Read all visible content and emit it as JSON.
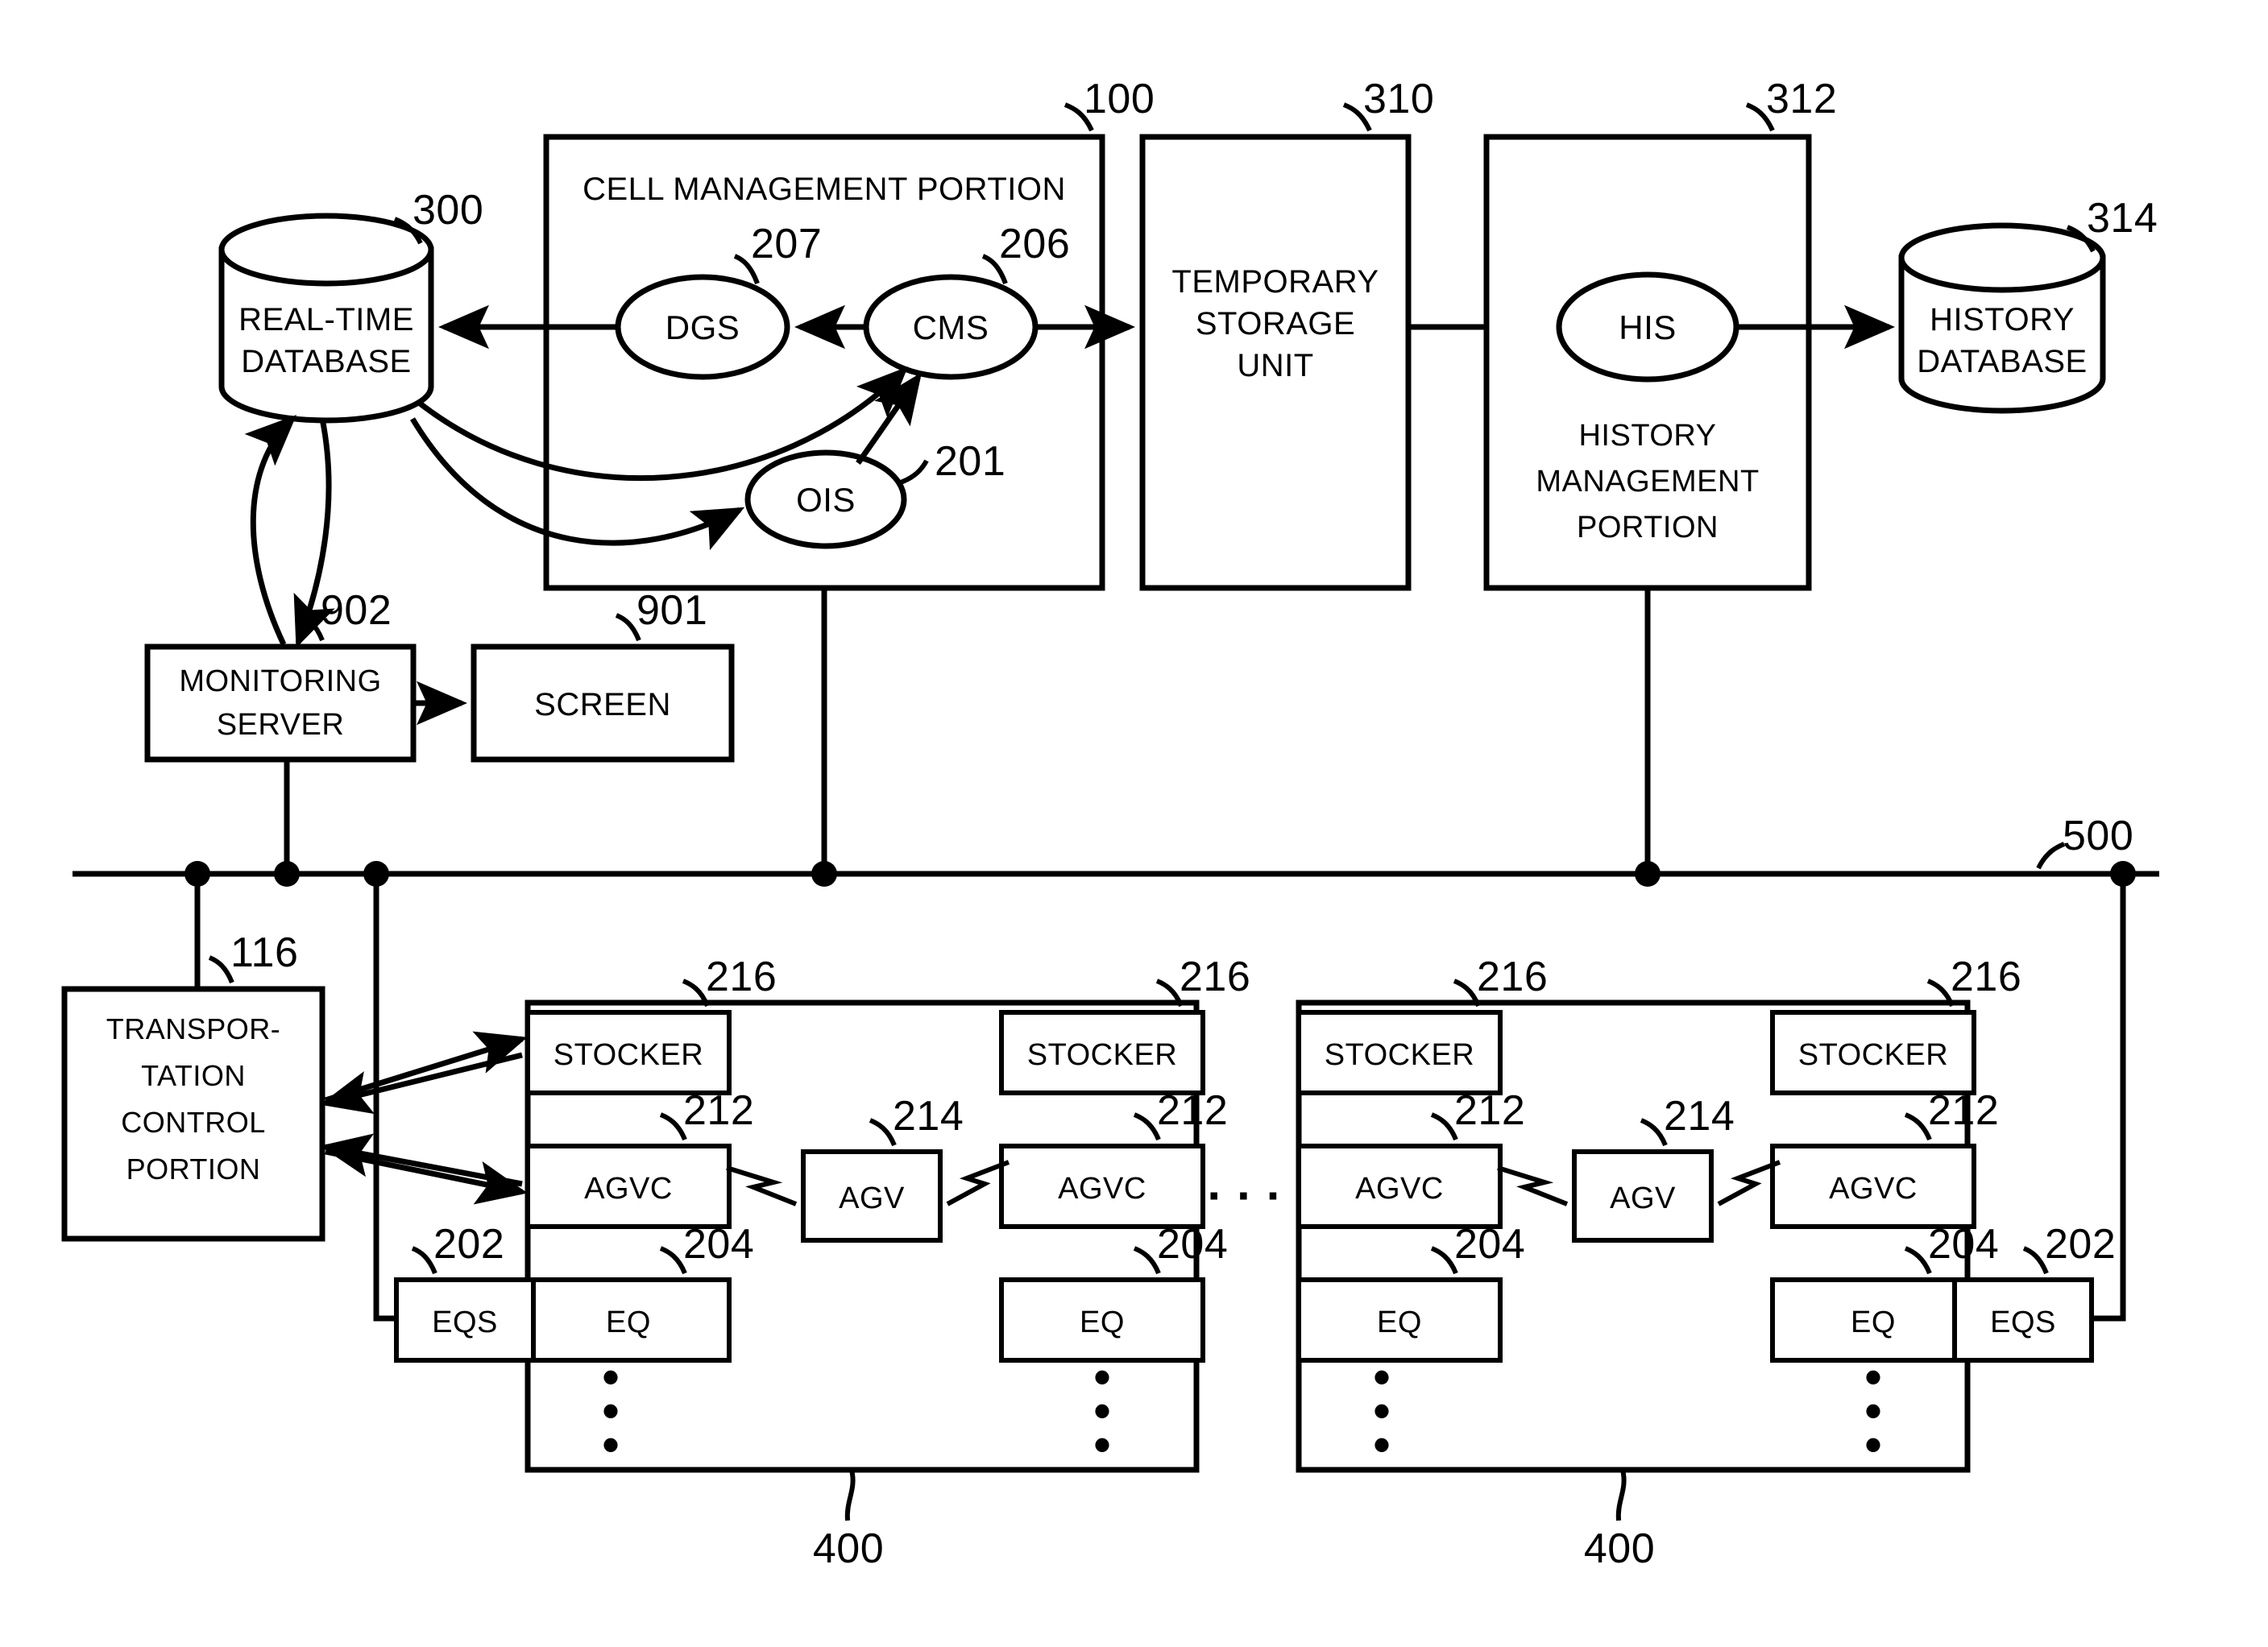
{
  "figure": {
    "type": "patent-block-diagram",
    "background": "#ffffff",
    "line_color": "#000000"
  },
  "top_section": {
    "real_time_database": {
      "label_line1": "REAL-TIME",
      "label_line2": "DATABASE",
      "ref": "300",
      "shape": "cylinder"
    },
    "cell_management_portion": {
      "title": "CELL MANAGEMENT PORTION",
      "ref": "100",
      "nodes": [
        {
          "label": "DGS",
          "ref": "207",
          "shape": "ellipse"
        },
        {
          "label": "CMS",
          "ref": "206",
          "shape": "ellipse"
        },
        {
          "label": "OIS",
          "ref": "201",
          "shape": "ellipse"
        }
      ]
    },
    "temporary_storage_unit": {
      "label_line1": "TEMPORARY",
      "label_line2": "STORAGE",
      "label_line3": "UNIT",
      "ref": "310",
      "shape": "rect"
    },
    "history_management_portion": {
      "node_label": "HIS",
      "label_line1": "HISTORY",
      "label_line2": "MANAGEMENT",
      "label_line3": "PORTION",
      "ref": "312",
      "shape": "rect"
    },
    "history_database": {
      "label_line1": "HISTORY",
      "label_line2": "DATABASE",
      "ref": "314",
      "shape": "cylinder"
    }
  },
  "middle_section": {
    "monitoring_server": {
      "label_line1": "MONITORING",
      "label_line2": "SERVER",
      "ref": "902"
    },
    "screen": {
      "label": "SCREEN",
      "ref": "901"
    },
    "bus": {
      "ref": "500"
    }
  },
  "bottom_section": {
    "transportation_control_portion": {
      "label_line1": "TRANSPOR-",
      "label_line2": "TATION",
      "label_line3": "CONTROL",
      "label_line4": "PORTION",
      "ref": "116"
    },
    "cell_groups": [
      {
        "ref": "400",
        "left_column": [
          {
            "label": "STOCKER",
            "ref": "216"
          },
          {
            "label": "AGVC",
            "ref": "212"
          },
          {
            "label": "EQ",
            "ref": "204"
          }
        ],
        "right_column": [
          {
            "label": "STOCKER",
            "ref": "216"
          },
          {
            "label": "AGVC",
            "ref": "212"
          },
          {
            "label": "EQ",
            "ref": "204"
          }
        ],
        "center": {
          "label": "AGV",
          "ref": "214"
        },
        "vertical_ellipsis": "⋮"
      },
      {
        "ref": "400",
        "left_column": [
          {
            "label": "STOCKER",
            "ref": "216"
          },
          {
            "label": "AGVC",
            "ref": "212"
          },
          {
            "label": "EQ",
            "ref": "204"
          }
        ],
        "right_column": [
          {
            "label": "STOCKER",
            "ref": "216"
          },
          {
            "label": "AGVC",
            "ref": "212"
          },
          {
            "label": "EQ",
            "ref": "204"
          }
        ],
        "center": {
          "label": "AGV",
          "ref": "214"
        },
        "vertical_ellipsis": "⋮"
      }
    ],
    "eqs_left": {
      "label": "EQS",
      "ref": "202"
    },
    "eqs_right": {
      "label": "EQS",
      "ref": "202"
    },
    "group_separator": "· · ·"
  }
}
